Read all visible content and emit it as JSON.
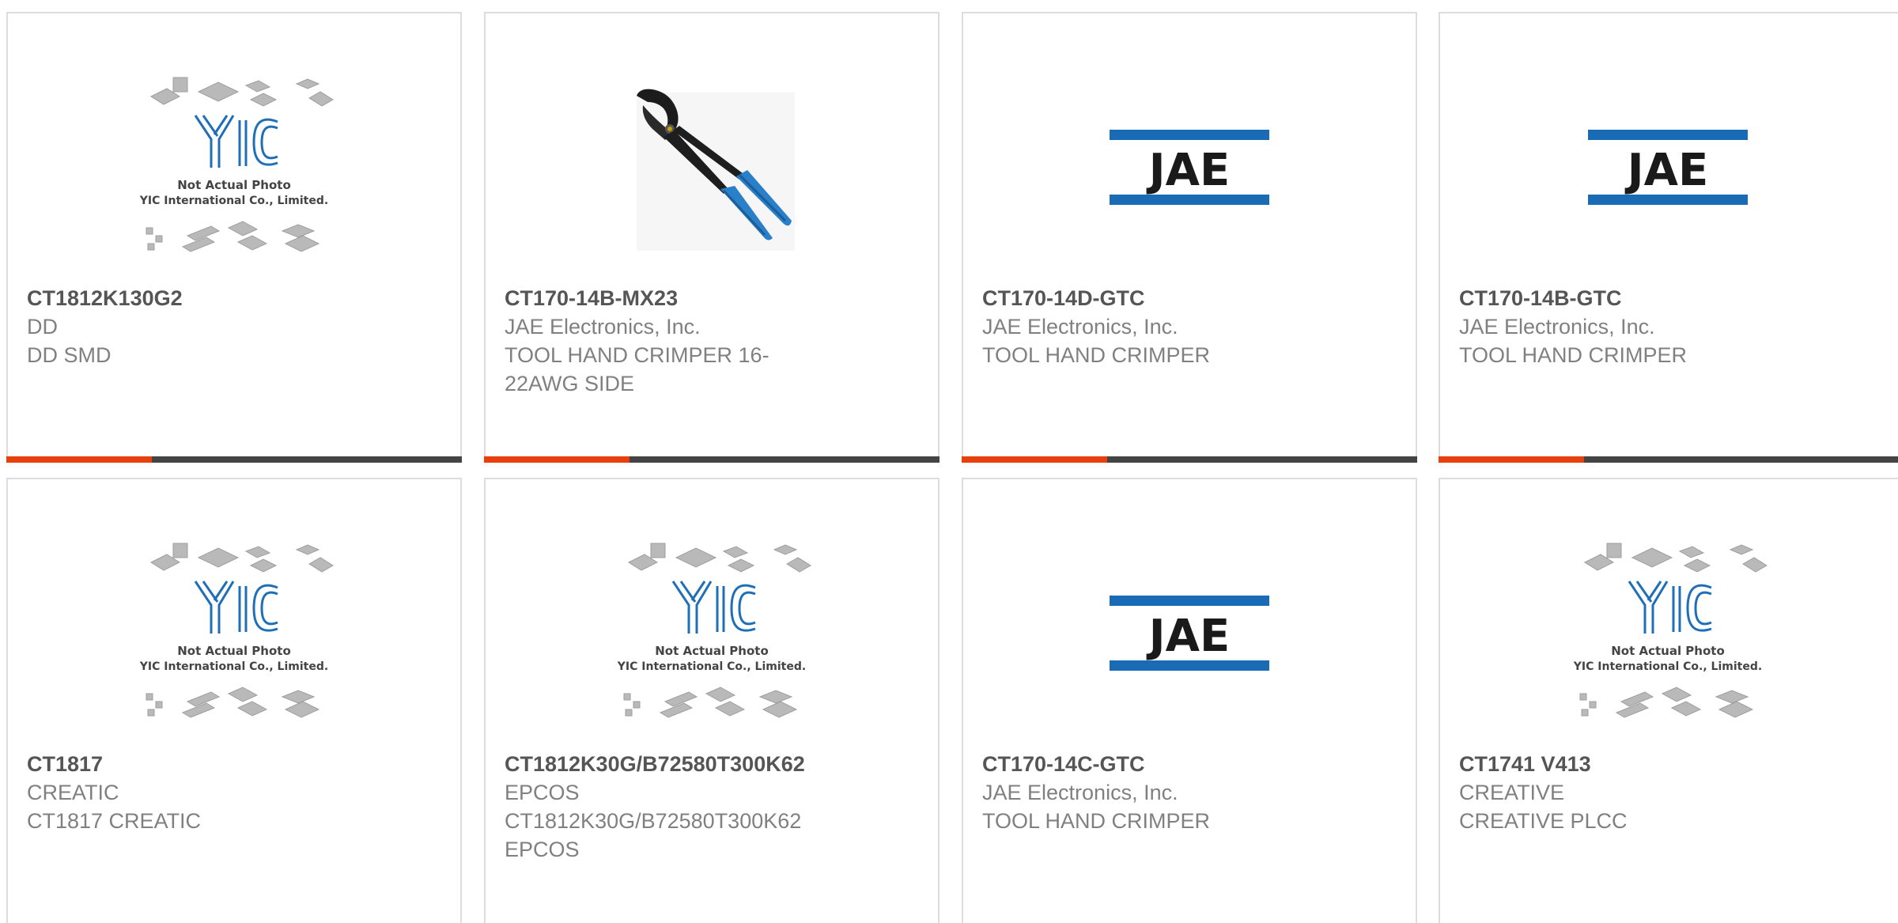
{
  "accent_color": "#e8400c",
  "products": [
    {
      "part_number": "CT1812K130G2",
      "manufacturer": "DD",
      "description": "DD SMD",
      "image": "yic-placeholder",
      "image_text": {
        "line1": "Not Actual Photo",
        "line2": "YIC International Co., Limited."
      }
    },
    {
      "part_number": "CT170-14B-MX23",
      "manufacturer": "JAE Electronics, Inc.",
      "description": "TOOL HAND CRIMPER 16-22AWG SIDE",
      "image": "crimper-tool-photo"
    },
    {
      "part_number": "CT170-14D-GTC",
      "manufacturer": "JAE Electronics, Inc.",
      "description": "TOOL HAND CRIMPER",
      "image": "jae-logo",
      "image_text": {
        "logo": "JAE"
      }
    },
    {
      "part_number": "CT170-14B-GTC",
      "manufacturer": "JAE Electronics, Inc.",
      "description": "TOOL HAND CRIMPER",
      "image": "jae-logo",
      "image_text": {
        "logo": "JAE"
      }
    },
    {
      "part_number": "CT1817",
      "manufacturer": "CREATIC",
      "description": "CT1817 CREATIC",
      "image": "yic-placeholder",
      "image_text": {
        "line1": "Not Actual Photo",
        "line2": "YIC International Co., Limited."
      }
    },
    {
      "part_number": "CT1812K30G/B72580T300K62",
      "manufacturer": "EPCOS",
      "description": "CT1812K30G/B72580T300K62 EPCOS",
      "image": "yic-placeholder",
      "image_text": {
        "line1": "Not Actual Photo",
        "line2": "YIC International Co., Limited."
      }
    },
    {
      "part_number": "CT170-14C-GTC",
      "manufacturer": "JAE Electronics, Inc.",
      "description": "TOOL HAND CRIMPER",
      "image": "jae-logo",
      "image_text": {
        "logo": "JAE"
      }
    },
    {
      "part_number": "CT1741 V413",
      "manufacturer": "CREATIVE",
      "description": "CREATIVE PLCC",
      "image": "yic-placeholder",
      "image_text": {
        "line1": "Not Actual Photo",
        "line2": "YIC International Co., Limited."
      }
    }
  ]
}
